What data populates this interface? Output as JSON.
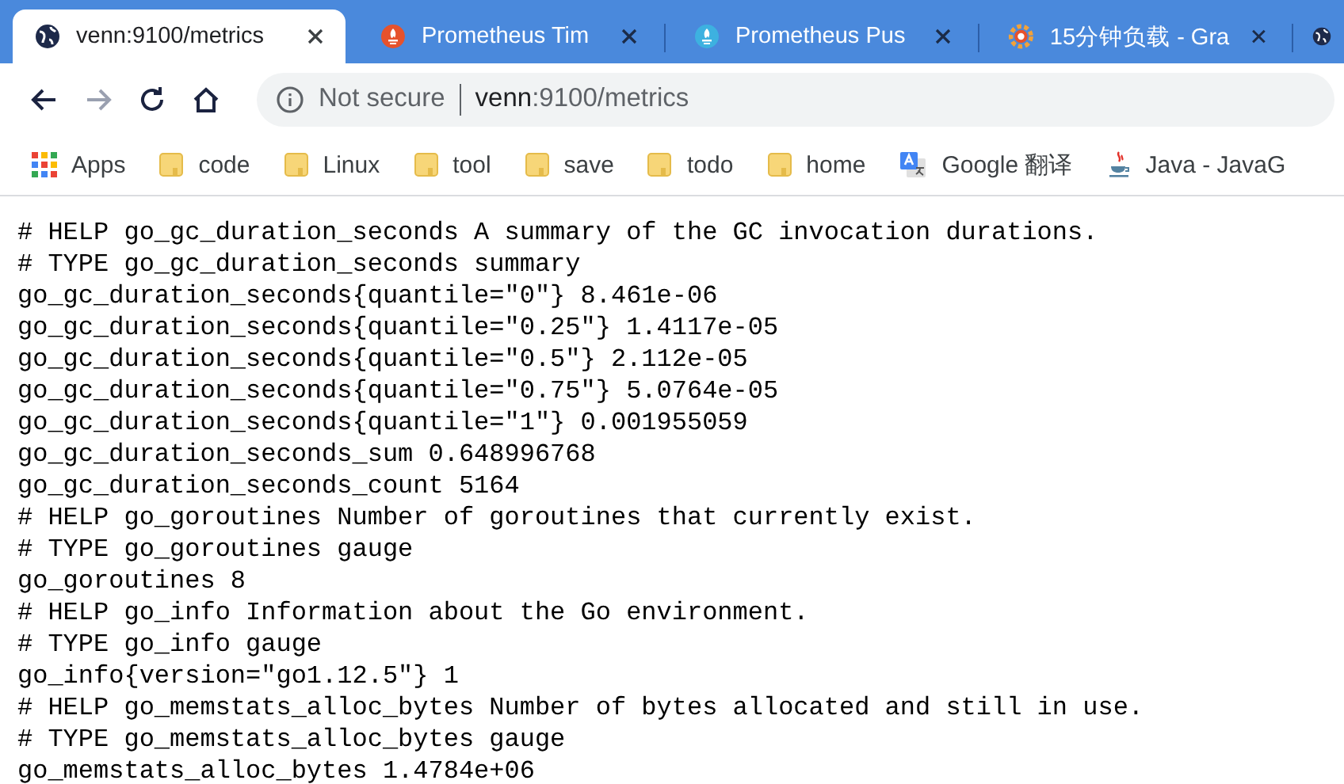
{
  "tabs": [
    {
      "title": "venn:9100/metrics",
      "kind": "globe",
      "selected": true
    },
    {
      "title": "Prometheus Tim",
      "kind": "prometheus",
      "selected": false
    },
    {
      "title": "Prometheus Pus",
      "kind": "pushgateway",
      "selected": false
    },
    {
      "title": "15分钟负载 - Gra",
      "kind": "grafana",
      "selected": false
    },
    {
      "kind": "globe",
      "selected": false
    }
  ],
  "nav": [
    {
      "kind": "back",
      "disabled": false
    },
    {
      "kind": "forward",
      "disabled": true
    },
    {
      "kind": "reload",
      "disabled": false
    },
    {
      "kind": "home",
      "disabled": false
    }
  ],
  "address": {
    "security": "Not secure",
    "host": "venn",
    "path": ":9100/metrics"
  },
  "bookmarks": [
    {
      "label": "Apps",
      "kind": "apps"
    },
    {
      "label": "code",
      "kind": "folder"
    },
    {
      "label": "Linux",
      "kind": "folder"
    },
    {
      "label": "tool",
      "kind": "folder"
    },
    {
      "label": "save",
      "kind": "folder"
    },
    {
      "label": "todo",
      "kind": "folder"
    },
    {
      "label": "home",
      "kind": "folder"
    },
    {
      "label": "Google 翻译",
      "kind": "translate"
    },
    {
      "label": "Java - JavaG",
      "kind": "java"
    }
  ],
  "lines": [
    "# HELP go_gc_duration_seconds A summary of the GC invocation durations.",
    "# TYPE go_gc_duration_seconds summary",
    "go_gc_duration_seconds{quantile=\"0\"} 8.461e-06",
    "go_gc_duration_seconds{quantile=\"0.25\"} 1.4117e-05",
    "go_gc_duration_seconds{quantile=\"0.5\"} 2.112e-05",
    "go_gc_duration_seconds{quantile=\"0.75\"} 5.0764e-05",
    "go_gc_duration_seconds{quantile=\"1\"} 0.001955059",
    "go_gc_duration_seconds_sum 0.648996768",
    "go_gc_duration_seconds_count 5164",
    "# HELP go_goroutines Number of goroutines that currently exist.",
    "# TYPE go_goroutines gauge",
    "go_goroutines 8",
    "# HELP go_info Information about the Go environment.",
    "# TYPE go_info gauge",
    "go_info{version=\"go1.12.5\"} 1",
    "# HELP go_memstats_alloc_bytes Number of bytes allocated and still in use.",
    "# TYPE go_memstats_alloc_bytes gauge",
    "go_memstats_alloc_bytes 1.4784e+06"
  ]
}
